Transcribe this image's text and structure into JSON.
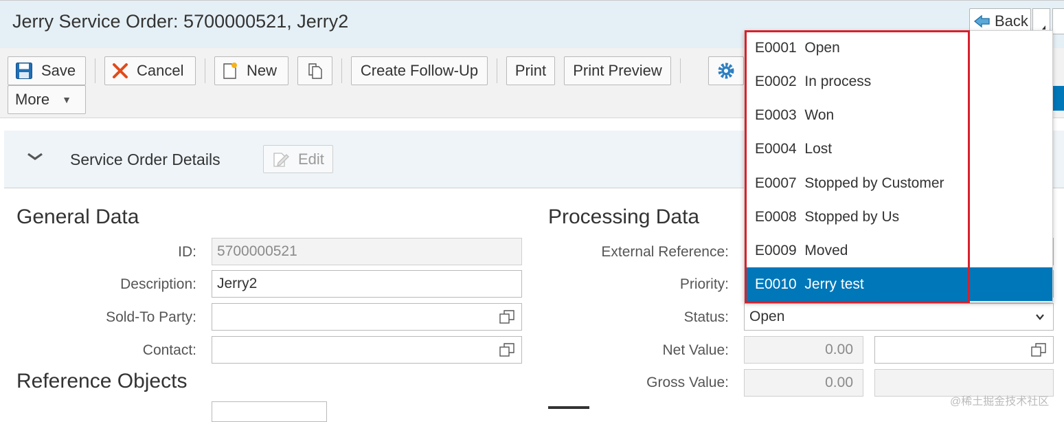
{
  "header": {
    "title": "Jerry Service Order: 5700000521, Jerry2",
    "back_label": "Back"
  },
  "toolbar": {
    "save_label": "Save",
    "cancel_label": "Cancel",
    "new_label": "New",
    "create_follow_up_label": "Create Follow-Up",
    "print_label": "Print",
    "print_preview_label": "Print Preview",
    "more_label": "More"
  },
  "section": {
    "title": "Service Order Details",
    "edit_label": "Edit"
  },
  "general_data": {
    "title": "General Data",
    "id_label": "ID:",
    "id_value": "5700000521",
    "description_label": "Description:",
    "description_value": "Jerry2",
    "sold_to_label": "Sold-To Party:",
    "sold_to_value": "",
    "contact_label": "Contact:",
    "contact_value": ""
  },
  "reference_objects": {
    "title": "Reference Objects"
  },
  "processing_data": {
    "title": "Processing Data",
    "external_reference_label": "External Reference:",
    "priority_label": "Priority:",
    "status_label": "Status:",
    "status_value": "Open",
    "net_value_label": "Net Value:",
    "net_value": "0.00",
    "gross_value_label": "Gross Value:",
    "gross_value": "0.00"
  },
  "status_dropdown": {
    "options": [
      {
        "code": "E0001",
        "text": "Open"
      },
      {
        "code": "E0002",
        "text": "In process"
      },
      {
        "code": "E0003",
        "text": "Won"
      },
      {
        "code": "E0004",
        "text": "Lost"
      },
      {
        "code": "E0007",
        "text": "Stopped by Customer"
      },
      {
        "code": "E0008",
        "text": "Stopped by Us"
      },
      {
        "code": "E0009",
        "text": "Moved"
      },
      {
        "code": "E0010",
        "text": "Jerry test"
      }
    ],
    "option_labels": [
      "E0001  Open",
      "E0002  In process",
      "E0003  Won",
      "E0004  Lost",
      "E0007  Stopped by Customer",
      "E0008  Stopped by Us",
      "E0009  Moved",
      "E0010  Jerry test"
    ],
    "selected_index": 7,
    "selected_color": "#0077b9",
    "highlight_color": "#d9202a"
  },
  "watermark": "@稀土掘金技术社区",
  "icons": [
    "save-icon",
    "cancel-icon",
    "new-icon",
    "copy-icon",
    "settings-icon",
    "back-arrow-icon",
    "chevron-down-icon",
    "value-help-icon",
    "edit-icon",
    "collapse-icon"
  ]
}
